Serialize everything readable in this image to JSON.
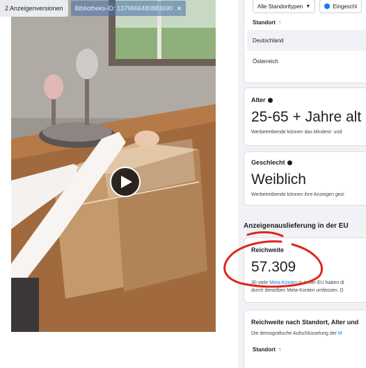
{
  "overlay": {
    "versions_label": "2 Anzeigenversionen",
    "library_id_label": "Bibliotheks-ID: 1379666480883690",
    "close_glyph": "×"
  },
  "panel": {
    "filters": {
      "location_type": "Alle Standorttypen",
      "included": "Eingeschl"
    },
    "location_table": {
      "header": "Standort",
      "rows": [
        "Deutschland",
        "Österreich"
      ]
    },
    "age": {
      "title": "Alter",
      "value": "25-65 + Jahre alt",
      "note": "Werbetreibende können das Mindest- und"
    },
    "gender": {
      "title": "Geschlecht",
      "value": "Weiblich",
      "note": "Werbetreibende können ihre Anzeigen gezi"
    },
    "delivery": {
      "section_title": "Anzeigenauslieferung in der EU",
      "reach_title": "Reichweite",
      "reach_value": "57.309",
      "note_prefix": "30 viele",
      "note_link": "Meta-Konten",
      "note_suffix": "in in der EU haben di",
      "note_line2": "durch dieselben Meta-Konten umfassen. D"
    },
    "breakdown": {
      "title": "Reichweite nach Standort, Alter und",
      "desc_prefix": "Die demografische Aufschlüsselung der",
      "desc_link": "M",
      "table_header": "Standort"
    }
  },
  "colors": {
    "accent": "#1877f2",
    "annotation": "#e0241b",
    "panel_bg": "#f0f2f5"
  }
}
